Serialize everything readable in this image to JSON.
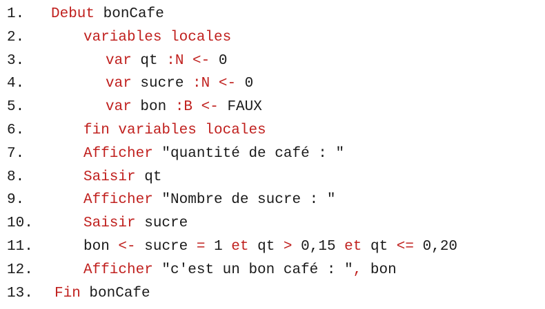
{
  "code": {
    "lines": [
      {
        "num": "1.",
        "parts": [
          {
            "t": "Debut",
            "k": "kw"
          },
          {
            "t": " bonCafe",
            "k": "tx"
          }
        ]
      },
      {
        "num": "2.",
        "parts": [
          {
            "t": "variables locales",
            "k": "kw"
          }
        ]
      },
      {
        "num": "3.",
        "parts": [
          {
            "t": "var",
            "k": "kw"
          },
          {
            "t": " qt ",
            "k": "tx"
          },
          {
            "t": ":N <-",
            "k": "kw"
          },
          {
            "t": " 0",
            "k": "tx"
          }
        ]
      },
      {
        "num": "4.",
        "parts": [
          {
            "t": "var",
            "k": "kw"
          },
          {
            "t": " sucre ",
            "k": "tx"
          },
          {
            "t": ":N <-",
            "k": "kw"
          },
          {
            "t": " 0",
            "k": "tx"
          }
        ]
      },
      {
        "num": "5.",
        "parts": [
          {
            "t": "var",
            "k": "kw"
          },
          {
            "t": " bon ",
            "k": "tx"
          },
          {
            "t": ":B <-",
            "k": "kw"
          },
          {
            "t": " FAUX",
            "k": "tx"
          }
        ]
      },
      {
        "num": "6.",
        "parts": [
          {
            "t": "fin variables locales",
            "k": "kw"
          }
        ]
      },
      {
        "num": "7.",
        "parts": [
          {
            "t": "Afficher",
            "k": "kw"
          },
          {
            "t": " \"quantité de café : \"",
            "k": "tx"
          }
        ]
      },
      {
        "num": "8.",
        "parts": [
          {
            "t": "Saisir",
            "k": "kw"
          },
          {
            "t": " qt",
            "k": "tx"
          }
        ]
      },
      {
        "num": "9.",
        "parts": [
          {
            "t": "Afficher",
            "k": "kw"
          },
          {
            "t": " \"Nombre de sucre : \"",
            "k": "tx"
          }
        ]
      },
      {
        "num": "10.",
        "parts": [
          {
            "t": "Saisir",
            "k": "kw"
          },
          {
            "t": " sucre",
            "k": "tx"
          }
        ]
      },
      {
        "num": "11.",
        "parts": [
          {
            "t": "bon ",
            "k": "tx"
          },
          {
            "t": "<-",
            "k": "kw"
          },
          {
            "t": " sucre ",
            "k": "tx"
          },
          {
            "t": "=",
            "k": "kw"
          },
          {
            "t": " 1 ",
            "k": "tx"
          },
          {
            "t": "et",
            "k": "kw"
          },
          {
            "t": " qt ",
            "k": "tx"
          },
          {
            "t": ">",
            "k": "kw"
          },
          {
            "t": " 0,15 ",
            "k": "tx"
          },
          {
            "t": "et",
            "k": "kw"
          },
          {
            "t": " qt ",
            "k": "tx"
          },
          {
            "t": "<=",
            "k": "kw"
          },
          {
            "t": " 0,20",
            "k": "tx"
          }
        ]
      },
      {
        "num": "12.",
        "parts": [
          {
            "t": "Afficher",
            "k": "kw"
          },
          {
            "t": " \"c'est un bon café : \"",
            "k": "tx"
          },
          {
            "t": ",",
            "k": "kw"
          },
          {
            "t": " bon",
            "k": "tx"
          }
        ]
      },
      {
        "num": "13.",
        "parts": [
          {
            "t": "Fin",
            "k": "kw"
          },
          {
            "t": " bonCafe",
            "k": "tx"
          }
        ]
      }
    ]
  },
  "colors": {
    "keyword": "#c0201e",
    "text": "#1a1a1a",
    "background": "#ffffff"
  }
}
